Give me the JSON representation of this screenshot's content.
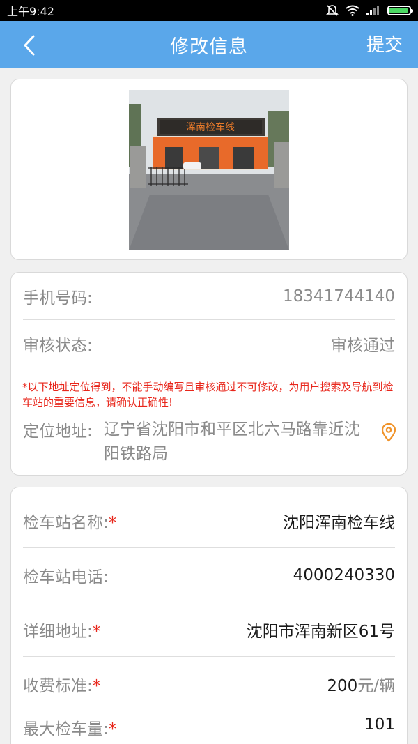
{
  "status_bar": {
    "time": "上午9:42",
    "icons": [
      "mute-icon",
      "wifi-icon",
      "signal-icon",
      "battery-icon"
    ]
  },
  "app_bar": {
    "title": "修改信息",
    "submit_label": "提交",
    "back_icon": "chevron-left-icon",
    "color": "#5aa7ea"
  },
  "photo": {
    "sign_text": "浑南检车线"
  },
  "info": {
    "phone_label": "手机号码:",
    "phone_value": "18341744140",
    "status_label": "审核状态:",
    "status_value": "审核通过",
    "notice": "*以下地址定位得到，不能手动编写且审核通过不可修改，为用户搜索及导航到检车站的重要信息，请确认正确性!",
    "location_label": "定位地址:",
    "location_value": "辽宁省沈阳市和平区北六马路靠近沈阳铁路局",
    "location_icon": "map-pin-icon",
    "accent_color": "#f0932a"
  },
  "form": {
    "name_label": "检车站名称:",
    "name_value": "沈阳浑南检车线",
    "phone_label": "检车站电话:",
    "phone_value": "4000240330",
    "address_label": "详细地址:",
    "address_value": "沈阳市浑南新区61号",
    "fee_label": "收费标准:",
    "fee_value": "200",
    "fee_unit": "元/辆",
    "capacity_label": "最大检车量:",
    "capacity_value": "101",
    "required_mark": "*",
    "required_color": "#e8261b"
  }
}
